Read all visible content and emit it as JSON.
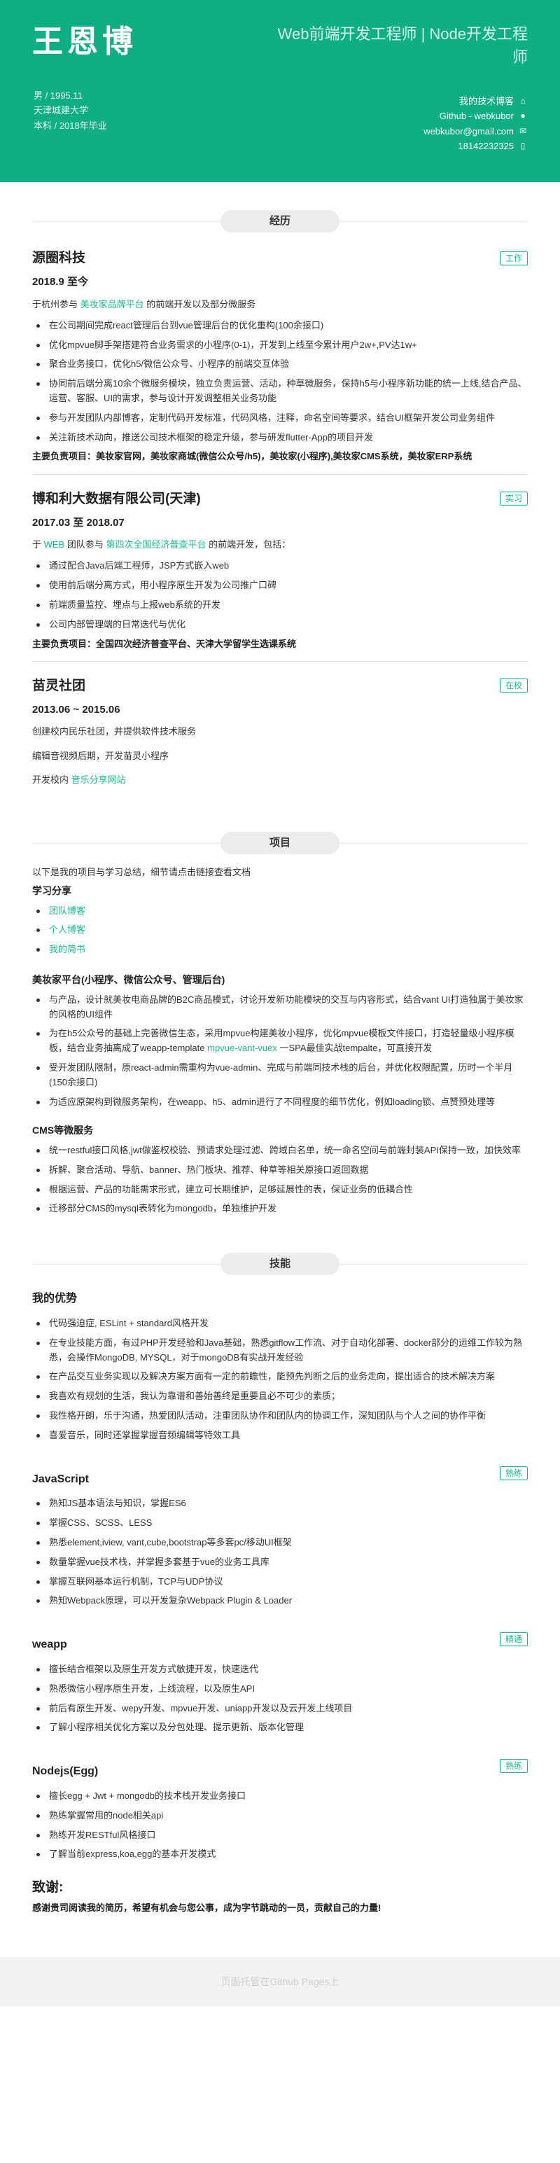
{
  "header": {
    "name": "王恩博",
    "title": "Web前端开发工程师 | Node开发工程师",
    "meta": [
      "男 / 1995.11",
      "天津城建大学",
      "本科 / 2018年毕业"
    ],
    "contact": [
      {
        "text": "我的技术博客",
        "icon": "home-icon",
        "glyph": "⌂"
      },
      {
        "text": "Github - webkubor",
        "icon": "github-icon",
        "glyph": "●"
      },
      {
        "text": "webkubor@gmail.com",
        "icon": "mail-icon",
        "glyph": "✉"
      },
      {
        "text": "18142232325",
        "icon": "phone-icon",
        "glyph": "▯"
      }
    ]
  },
  "sections": {
    "experience": "经历",
    "projects": "项目",
    "skills": "技能"
  },
  "jobs": {
    "yuanquan": {
      "name": "源圈科技",
      "tag": "工作",
      "period": "2018.9 至今",
      "intro_pre": "于杭州参与 ",
      "intro_link": "美妆家品牌平台",
      "intro_post": " 的前端开发以及部分微服务",
      "items": [
        "在公司期间完成react管理后台到vue管理后台的优化重构(100余接口)",
        "优化mpvue脚手架搭建符合业务需求的小程序(0-1)，开发到上线至今累计用户2w+,PV达1w+",
        "聚合业务接口，优化h5/微信公众号、小程序的前端交互体验",
        "协同前后端分离10余个微服务模块，独立负责运营、活动，种草微服务，保持h5与小程序新功能的统一上线,结合产品、运营、客服、UI的需求，参与设计开发调整相关业务功能",
        "参与开发团队内部博客，定制代码开发标准，代码风格，注释，命名空间等要求，结合UI框架开发公司业务组件",
        "关注新技术动向，推送公司技术框架的稳定升级，参与研发flutter-App的项目开发"
      ],
      "main": "主要负责项目：美妆家官网，美妆家商城(微信公众号/h5)，美妆家(小程序),美妆家CMS系统，美妆家ERP系统"
    },
    "bohe": {
      "name": "博和利大数据有限公司(天津)",
      "tag": "实习",
      "period": "2017.03 至 2018.07",
      "intro_pre": "于 ",
      "intro_link1": "WEB",
      "intro_mid": " 团队参与 ",
      "intro_link2": "第四次全国经济普查平台",
      "intro_post": " 的前端开发，包括：",
      "items": [
        "通过配合Java后端工程师，JSP方式嵌入web",
        "使用前后端分离方式，用小程序原生开发为公司推广口碑",
        "前端质量监控、埋点与上报web系统的开发",
        "公司内部管理端的日常迭代与优化"
      ],
      "main": "主要负责项目：全国四次经济普查平台、天津大学留学生选课系统"
    },
    "miaoling": {
      "name": "苗灵社团",
      "tag": "在校",
      "period": "2013.06 ~ 2015.06",
      "lines": [
        "创建校内民乐社团，并提供软件技术服务",
        "编辑音视频后期，开发苗灵小程序"
      ],
      "dev_pre": "开发校内 ",
      "dev_link": "音乐分享网站"
    }
  },
  "projects": {
    "intro": "以下是我的项目与学习总结，细节请点击链接查看文档",
    "study_title": "学习分享",
    "study_links": [
      "团队博客",
      "个人博客",
      "我的简书"
    ],
    "p1_title": "美妆家平台(小程序、微信公众号、管理后台)",
    "p1_items": [
      "与产品，设计就美妆电商品牌的B2C商品模式，讨论开发新功能模块的交互与内容形式，结合vant UI打造独属于美妆家的风格的UI组件",
      "为在h5公众号的基础上完善微信生态，采用mpvue构建美妆小程序，优化mpvue模板文件接口，打造轻量级小程序模板，结合业务抽离成了weapp-template ",
      "受开发团队限制，原react-admin需重构为vue-admin、完成与前端同技术栈的后台，并优化权限配置，历时一个半月(150余接口)",
      "为适应原架构到微服务架构，在weapp、h5、admin进行了不同程度的细节优化，例如loading锁、点赞预处理等"
    ],
    "p1_item2_link": "mpvue-vant-vuex",
    "p1_item2_post": " 一SPA最佳实战tempalte，可直接开发",
    "p2_title": "CMS等微服务",
    "p2_items": [
      "统一restful接口风格,jwt做鉴权校验、预请求处理过滤、跨域白名单，统一命名空间与前端封装API保持一致，加快效率",
      "拆解、聚合活动、导航、banner、热门板块、推荐、种草等相关原接口返回数据",
      "根据运营、产品的功能需求形式，建立可长期维护，足够延展性的表，保证业务的低耦合性",
      "迁移部分CMS的mysql表转化为mongodb，单独维护开发"
    ]
  },
  "skills": {
    "adv_title": "我的优势",
    "adv_items": [
      "代码强迫症, ESLint + standard风格开发",
      "在专业技能方面，有过PHP开发经验和Java基础，熟悉gitflow工作流、对于自动化部署、docker部分的运维工作较为熟悉，会操作MongoDB, MYSQL，对于mongoDB有实战开发经验",
      "在产品交互业务实现以及解决方案方面有一定的前瞻性，能预先判断之后的业务走向，提出适合的技术解决方案",
      "我喜欢有规划的生活，我认为靠谱和善始善终是重要且必不可少的素质；",
      "我性格开朗，乐于沟通，热爱团队活动，注重团队协作和团队内的协调工作，深知团队与个人之间的协作平衡",
      "喜爱音乐，同时还掌握掌握音频编辑等特效工具"
    ],
    "groups": [
      {
        "name": "JavaScript",
        "tag": "熟练",
        "items": [
          "熟知JS基本语法与知识，掌握ES6",
          "掌握CSS、SCSS、LESS",
          "熟悉element,iview, vant,cube,bootstrap等多套pc/移动UI框架",
          "数量掌握vue技术栈，并掌握多套基于vue的业务工具库",
          "掌握互联网基本运行机制，TCP与UDP协议",
          "熟知Webpack原理，可以开发复杂Webpack Plugin & Loader"
        ]
      },
      {
        "name": "weapp",
        "tag": "精通",
        "items": [
          "擅长结合框架以及原生开发方式敏捷开发，快速迭代",
          "熟悉微信小程序原生开发，上线流程，以及原生API",
          "前后有原生开发、wepy开发、mpvue开发、uniapp开发以及云开发上线项目",
          "了解小程序相关优化方案以及分包处理、提示更新、版本化管理"
        ]
      },
      {
        "name": "Nodejs(Egg)",
        "tag": "熟练",
        "items": [
          "擅长egg + Jwt + mongodb的技术栈开发业务接口",
          "熟练掌握常用的node相关api",
          "熟练开发RESTful风格接口",
          "了解当前express,koa,egg的基本开发模式"
        ]
      }
    ],
    "thanks_title": "致谢:",
    "thanks_text": "感谢贵司阅读我的简历，希望有机会与您公事，成为字节跳动的一员，贡献自己的力量!"
  },
  "footer": "页面托管在Github Pages上"
}
